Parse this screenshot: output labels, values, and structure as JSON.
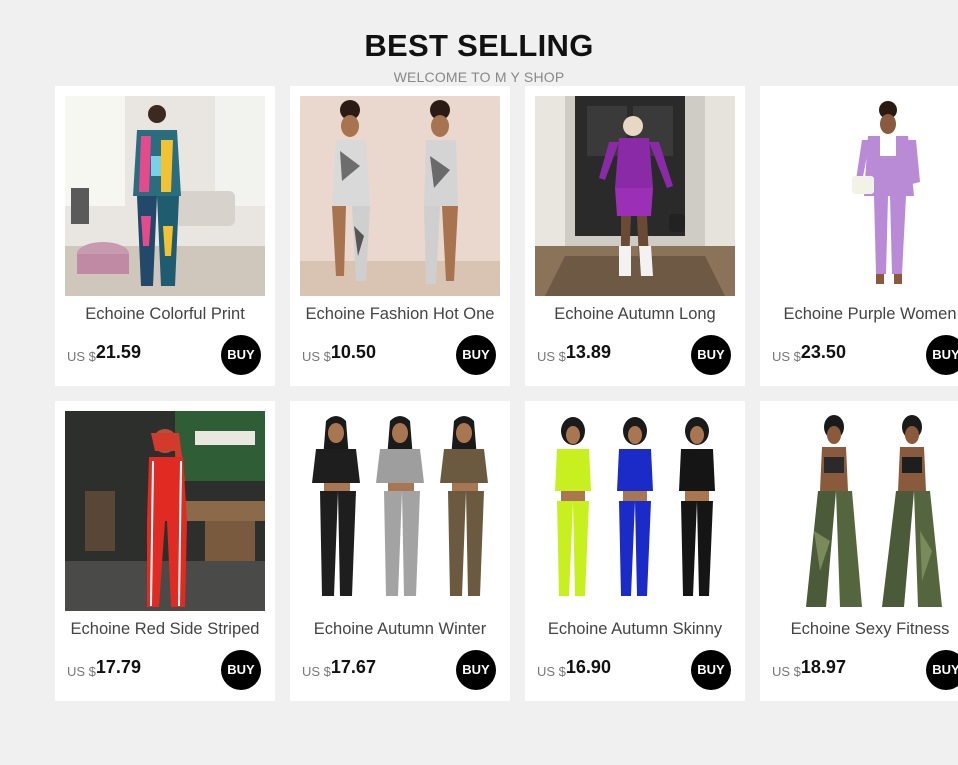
{
  "header": {
    "title": "BEST SELLING",
    "subtitle": "WELCOME TO M Y SHOP"
  },
  "buy_label": "BUY",
  "currency": "US $",
  "products": [
    {
      "name": "Echoine Colorful Print",
      "price": "21.59",
      "image": "photo-colorful-print-suit"
    },
    {
      "name": "Echoine Fashion Hot One",
      "price": "10.50",
      "image": "photo-one-shoulder-jumpsuit"
    },
    {
      "name": "Echoine Autumn Long",
      "price": "13.89",
      "image": "photo-purple-mini-dress"
    },
    {
      "name": "Echoine Purple Women",
      "price": "23.50",
      "image": "photo-purple-suit"
    },
    {
      "name": "Echoine Red Side Striped",
      "price": "17.79",
      "image": "photo-red-striped-set"
    },
    {
      "name": "Echoine Autumn Winter",
      "price": "17.67",
      "image": "photo-crop-top-joggers"
    },
    {
      "name": "Echoine Autumn Skinny",
      "price": "16.90",
      "image": "photo-zip-crop-set"
    },
    {
      "name": "Echoine Sexy Fitness",
      "price": "18.97",
      "image": "photo-camo-flare-pants"
    }
  ],
  "colors": {
    "background": "#f0f0f0",
    "card": "#ffffff",
    "buy_button": "#000000",
    "title": "#111111",
    "subtitle": "#888888"
  }
}
